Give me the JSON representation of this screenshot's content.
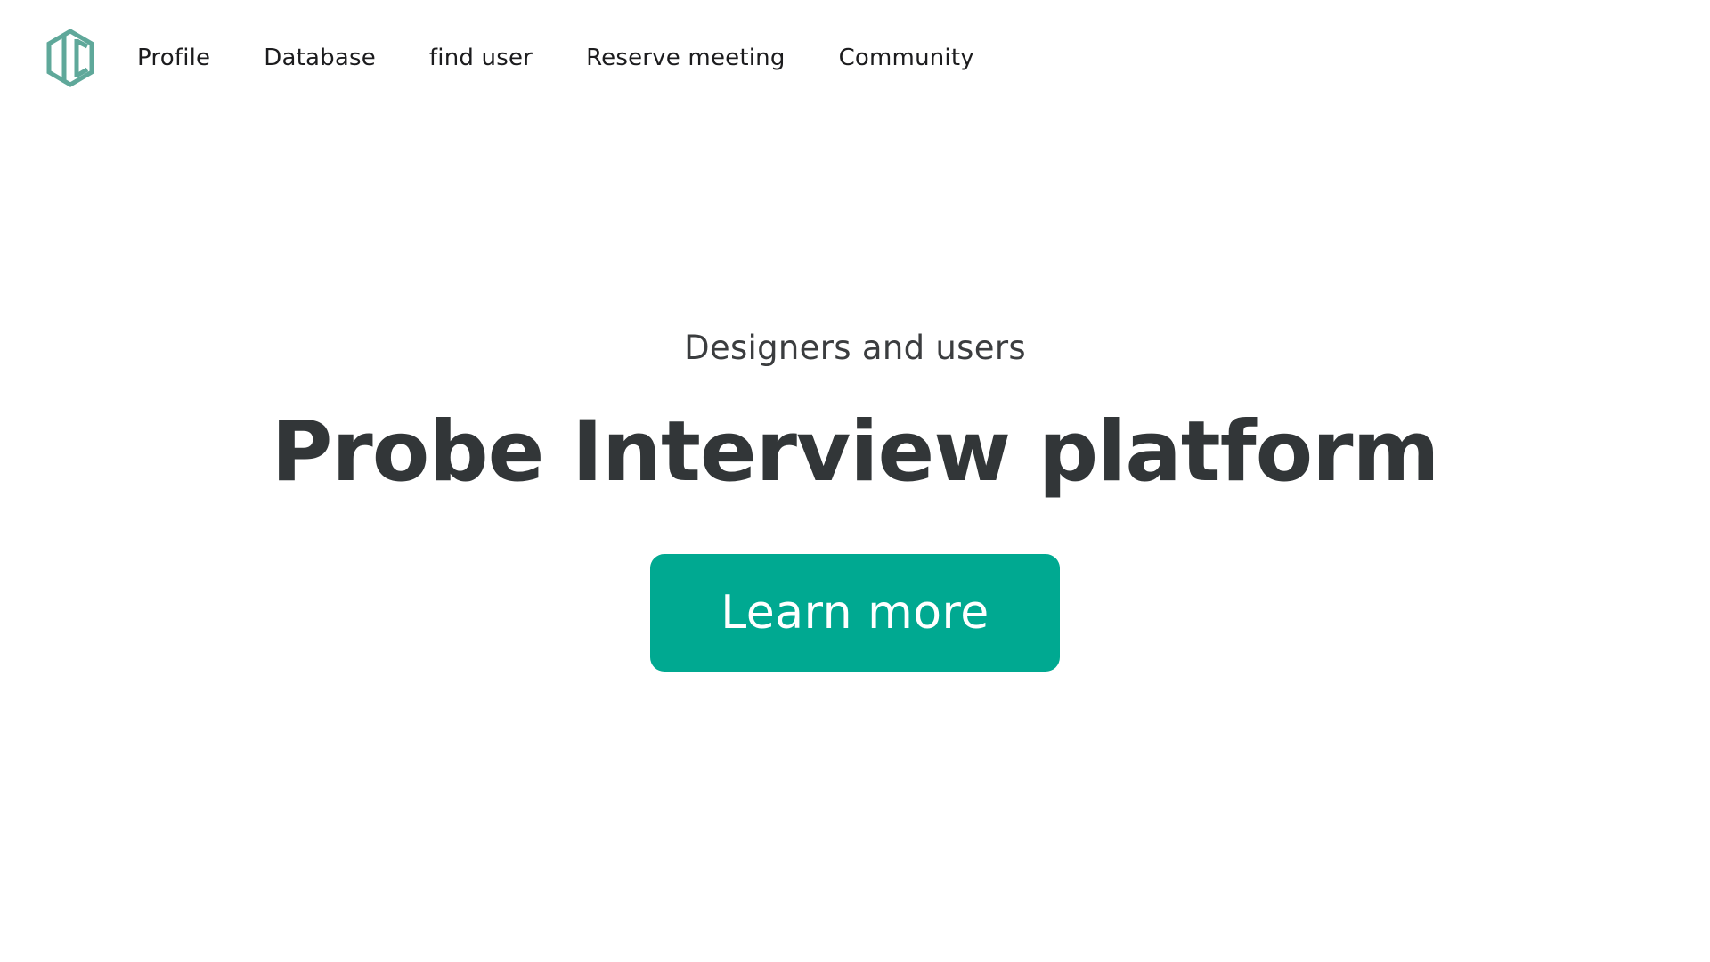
{
  "brand": {
    "logo_icon": "hexagon-bars-logo-icon",
    "logo_color": "#5fa89a"
  },
  "nav": {
    "items": [
      {
        "label": "Profile"
      },
      {
        "label": "Database"
      },
      {
        "label": "find user"
      },
      {
        "label": "Reserve meeting"
      },
      {
        "label": "Community"
      }
    ]
  },
  "hero": {
    "kicker": "Designers and users",
    "title": "Probe Interview platform",
    "cta_label": "Learn more",
    "cta_color": "#00a991",
    "text_color": "#323638"
  }
}
